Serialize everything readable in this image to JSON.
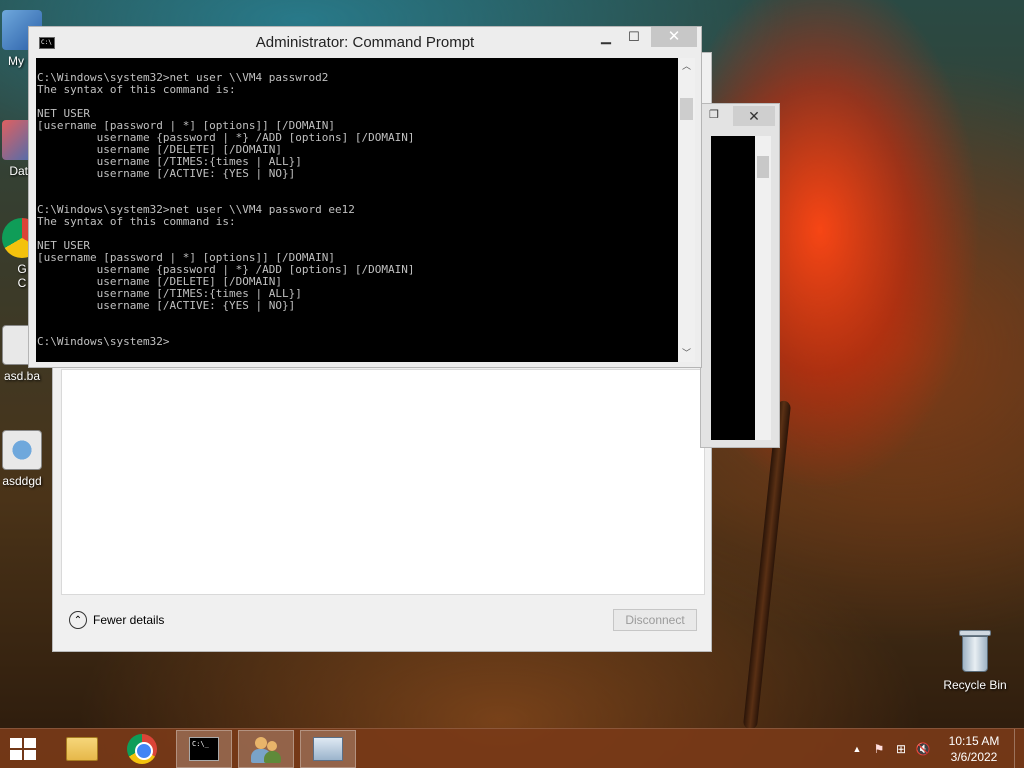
{
  "desktop": {
    "icons_left": [
      {
        "label": "My C",
        "name": "computer"
      },
      {
        "label": "Data",
        "name": "data"
      },
      {
        "label": "G\nC",
        "name": "chrome-shortcut"
      },
      {
        "label": "asd.ba",
        "name": "batch-file"
      },
      {
        "label": "asddgd",
        "name": "settings-file"
      }
    ],
    "recycle_bin": "Recycle Bin"
  },
  "cmd": {
    "title": "Administrator: Command Prompt",
    "minimize": "▁",
    "maximize": "☐",
    "close": "✕",
    "lines": [
      "",
      "C:\\Windows\\system32>net user \\\\VM4 passwrod2",
      "The syntax of this command is:",
      "",
      "NET USER",
      "[username [password | *] [options]] [/DOMAIN]",
      "         username {password | *} /ADD [options] [/DOMAIN]",
      "         username [/DELETE] [/DOMAIN]",
      "         username [/TIMES:{times | ALL}]",
      "         username [/ACTIVE: {YES | NO}]",
      "",
      "",
      "C:\\Windows\\system32>net user \\\\VM4 password ee12",
      "The syntax of this command is:",
      "",
      "NET USER",
      "[username [password | *] [options]] [/DOMAIN]",
      "         username {password | *} /ADD [options] [/DOMAIN]",
      "         username [/DELETE] [/DOMAIN]",
      "         username [/TIMES:{times | ALL}]",
      "         username [/ACTIVE: {YES | NO}]",
      "",
      "",
      "C:\\Windows\\system32>"
    ]
  },
  "cmd2": {
    "close": "✕"
  },
  "rdp": {
    "fewer_details": "Fewer details",
    "disconnect": "Disconnect"
  },
  "taskbar": {
    "items": [
      "file-explorer",
      "chrome",
      "command-prompt",
      "user-accounts",
      "performance-monitor"
    ],
    "tray": {
      "up_arrow": "▲",
      "flag": "⚑",
      "network": "⊞",
      "volume": "🔇",
      "time": "10:15 AM",
      "date": "3/6/2022"
    }
  }
}
